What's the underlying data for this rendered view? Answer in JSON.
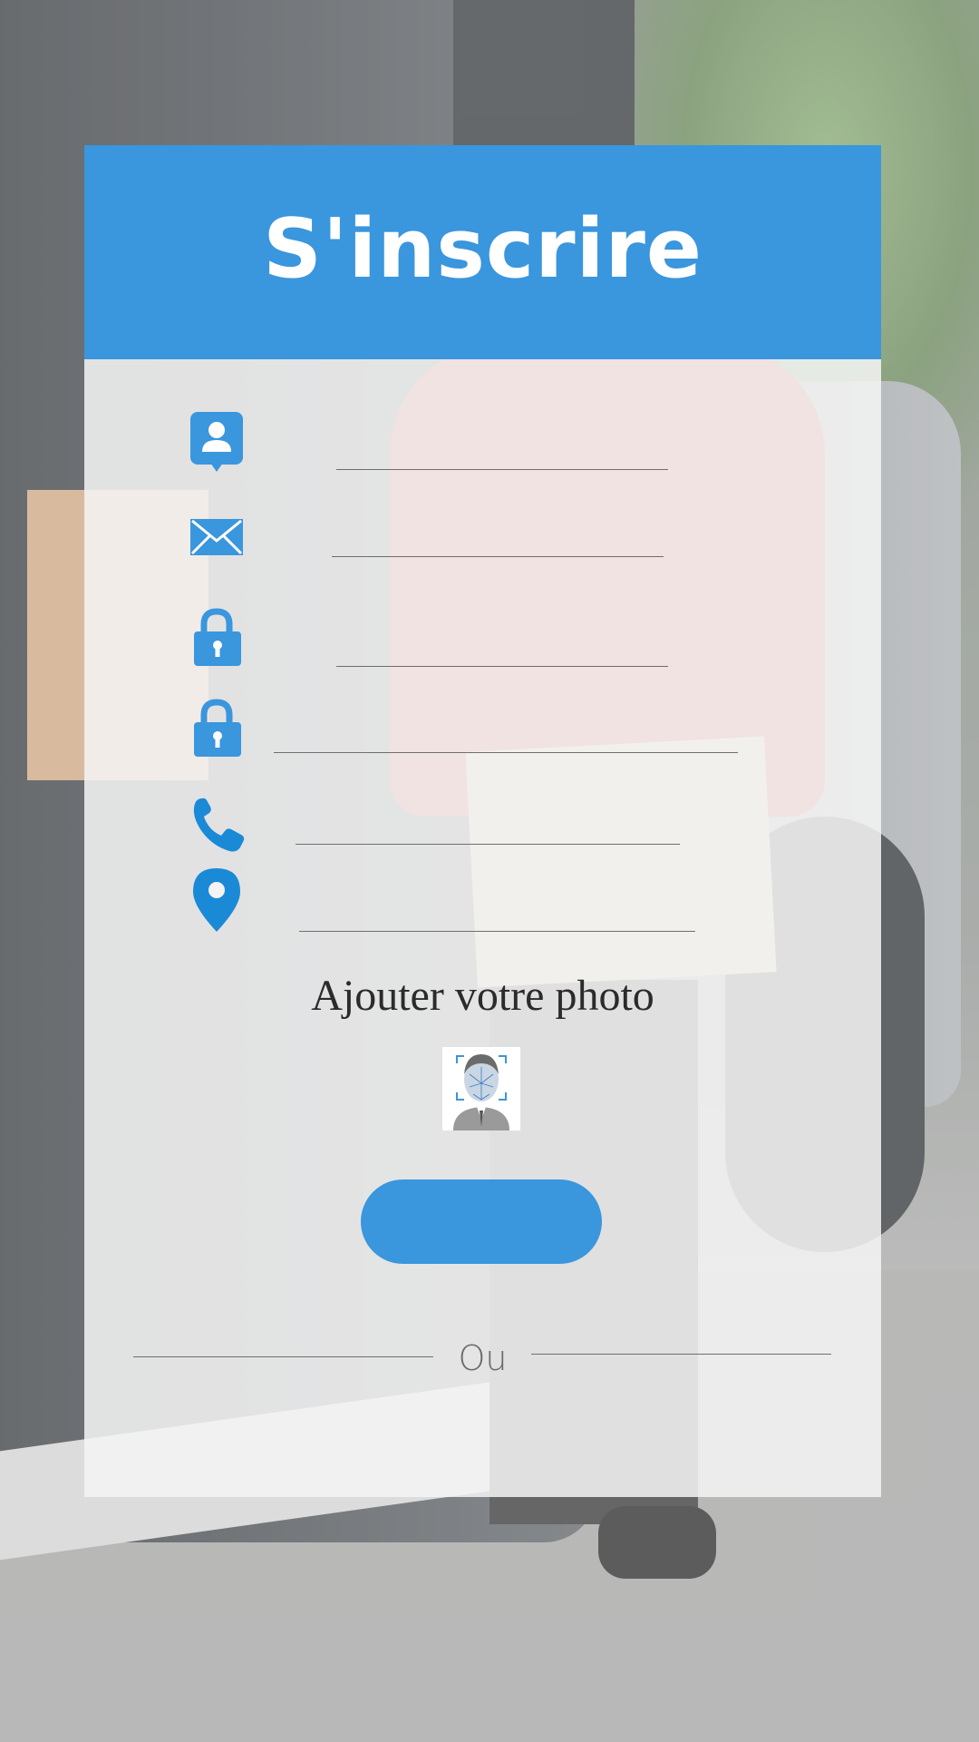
{
  "header": {
    "title": "S'inscrire"
  },
  "form": {
    "fields": [
      {
        "name": "name",
        "icon": "contact-card-icon",
        "value": ""
      },
      {
        "name": "email",
        "icon": "envelope-icon",
        "value": ""
      },
      {
        "name": "password",
        "icon": "lock-icon",
        "value": ""
      },
      {
        "name": "confirm-password",
        "icon": "lock-icon",
        "value": ""
      },
      {
        "name": "phone",
        "icon": "phone-icon",
        "value": ""
      },
      {
        "name": "location",
        "icon": "location-pin-icon",
        "value": ""
      }
    ]
  },
  "photo": {
    "label": "Ajouter votre photo",
    "icon": "face-scan-avatar-icon"
  },
  "submit": {
    "label": ""
  },
  "divider": {
    "text": "Ou"
  },
  "colors": {
    "accent": "#3a96dd",
    "icon_blue": "#1a8ad6",
    "card_bg": "#f4f4f4"
  }
}
